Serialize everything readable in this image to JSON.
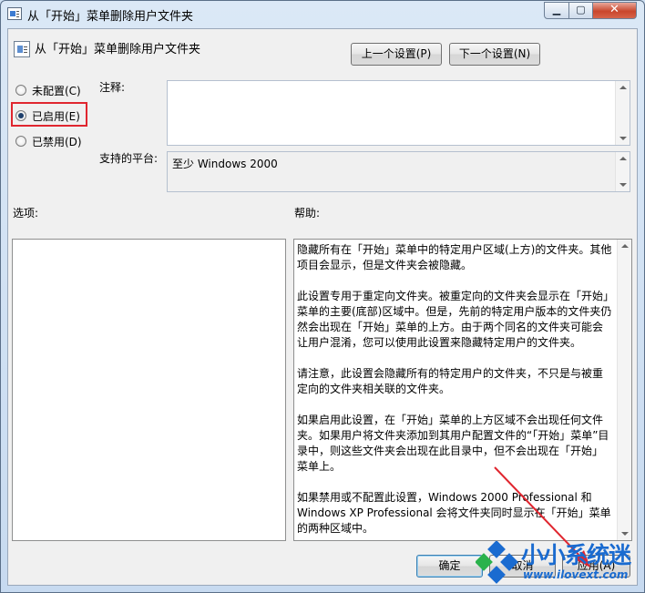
{
  "window": {
    "title": "从「开始」菜单删除用户文件夹",
    "min_symbol": "▁",
    "max_symbol": "▢",
    "close_symbol": "✕"
  },
  "header": {
    "policy_name": "从「开始」菜单删除用户文件夹",
    "prev_button": "上一个设置(P)",
    "next_button": "下一个设置(N)"
  },
  "state": {
    "options": [
      {
        "label": "未配置(C)",
        "checked": false
      },
      {
        "label": "已启用(E)",
        "checked": true
      },
      {
        "label": "已禁用(D)",
        "checked": false
      }
    ]
  },
  "comment": {
    "label": "注释:",
    "value": ""
  },
  "platform": {
    "label": "支持的平台:",
    "value": "至少 Windows 2000"
  },
  "options_section": {
    "label": "选项:"
  },
  "help_section": {
    "label": "帮助:",
    "paragraphs": [
      "隐藏所有在「开始」菜单中的特定用户区域(上方)的文件夹。其他项目会显示，但是文件夹会被隐藏。",
      "此设置专用于重定向文件夹。被重定向的文件夹会显示在「开始」菜单的主要(底部)区域中。但是，先前的特定用户版本的文件夹仍然会出现在「开始」菜单的上方。由于两个同名的文件夹可能会让用户混淆，您可以使用此设置来隐藏特定用户的文件夹。",
      "请注意，此设置会隐藏所有的特定用户的文件夹，不只是与被重定向的文件夹相关联的文件夹。",
      "如果启用此设置，在「开始」菜单的上方区域不会出现任何文件夹。如果用户将文件夹添加到其用户配置文件的“「开始」菜单”目录中，则这些文件夹会出现在此目录中，但不会出现在「开始」菜单上。",
      "如果禁用或不配置此设置，Windows 2000 Professional 和 Windows XP Professional 会将文件夹同时显示在「开始」菜单的两种区域中。"
    ]
  },
  "footer": {
    "ok_button": "确定",
    "cancel_button": "取消",
    "apply_button": "应用(A)"
  },
  "watermark": {
    "brand": "小小系统迷",
    "url": "www.ilovext.com"
  },
  "colors": {
    "highlight": "#e0262f",
    "arrow": "#e0262f",
    "brand": "#1a6bd0"
  }
}
